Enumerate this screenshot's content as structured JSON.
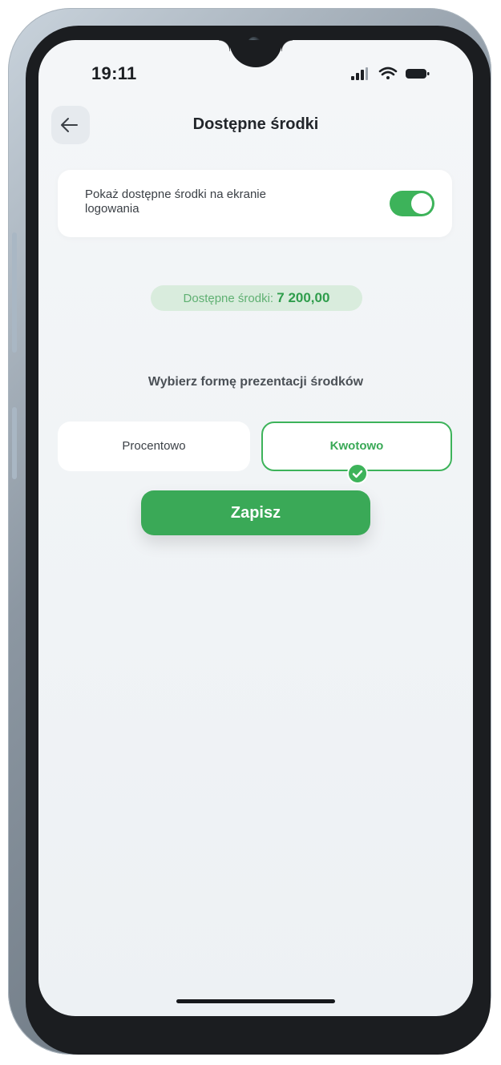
{
  "status_bar": {
    "time": "19:11",
    "icons": [
      "signal-icon",
      "wifi-icon",
      "battery-icon"
    ]
  },
  "header": {
    "back_icon": "arrow-left-icon",
    "title": "Dostępne środki"
  },
  "login_setting": {
    "label": "Pokaż dostępne środki na ekranie logowania",
    "toggle_on": true
  },
  "balance": {
    "prefix": "Dostępne środki:",
    "value": "7 200,00"
  },
  "presentation": {
    "label": "Wybierz formę prezentacji środków",
    "options": [
      {
        "label": "Procentowo",
        "selected": false
      },
      {
        "label": "Kwotowo",
        "selected": true
      }
    ]
  },
  "actions": {
    "save_label": "Zapisz"
  },
  "colors": {
    "accent": "#3DB35A",
    "background": "#EEF2F5",
    "card": "#FFFFFF"
  }
}
